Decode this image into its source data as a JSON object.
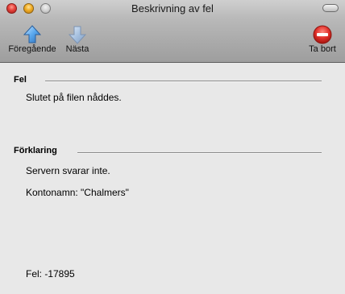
{
  "window": {
    "title": "Beskrivning av fel"
  },
  "toolbar": {
    "previous_label": "Föregående",
    "next_label": "Nästa",
    "delete_label": "Ta bort"
  },
  "sections": {
    "error_header": "Fel",
    "error_message": "Slutet på filen nåddes.",
    "explanation_header": "Förklaring",
    "explanation_line_1": "Servern svarar inte.",
    "explanation_line_2": "Kontonamn: \"Chalmers\""
  },
  "footer": {
    "error_code": "Fel: -17895"
  },
  "icons": {
    "previous": "up-arrow-icon",
    "next": "down-arrow-icon",
    "delete": "delete-icon"
  },
  "colors": {
    "arrow_active": "#4a9ae6",
    "arrow_disabled": "#9ab4d6",
    "delete_red": "#d8261d"
  }
}
